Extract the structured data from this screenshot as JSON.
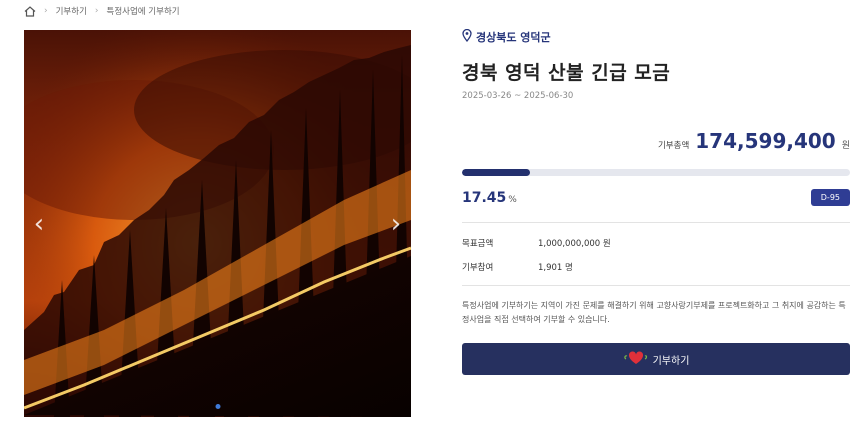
{
  "breadcrumb": {
    "items": [
      "기부하기",
      "특정사업에 기부하기"
    ]
  },
  "image": {
    "description_icon": "wildfire-photo",
    "current_slide": 1,
    "slide_count": 1
  },
  "campaign": {
    "region": "경상북도 영덕군",
    "title": "경북 영덕 산불 긴급 모금",
    "period": "2025-03-26 ~ 2025-06-30",
    "amount_label": "기부총액",
    "amount": "174,599,400",
    "amount_unit": "원",
    "progress_percent": 17.45,
    "percent_text": "17.45",
    "percent_unit": "%",
    "dday": "D-95",
    "goal_label": "목표금액",
    "goal_value": "1,000,000,000 원",
    "participants_label": "기부참여",
    "participants_value": "1,901 명",
    "description": "특정사업에 기부하기는 지역이 가진 문제를 해결하기 위해 고향사랑기부제를 프로젝트화하고 그 취지에 공감하는 특정사업을 직접 선택하여 기부할 수 있습니다.",
    "donate_label": "기부하기"
  },
  "colors": {
    "accent": "#26357a",
    "button": "#26305f",
    "progress": "#23306e",
    "badge": "#2f3d94"
  }
}
